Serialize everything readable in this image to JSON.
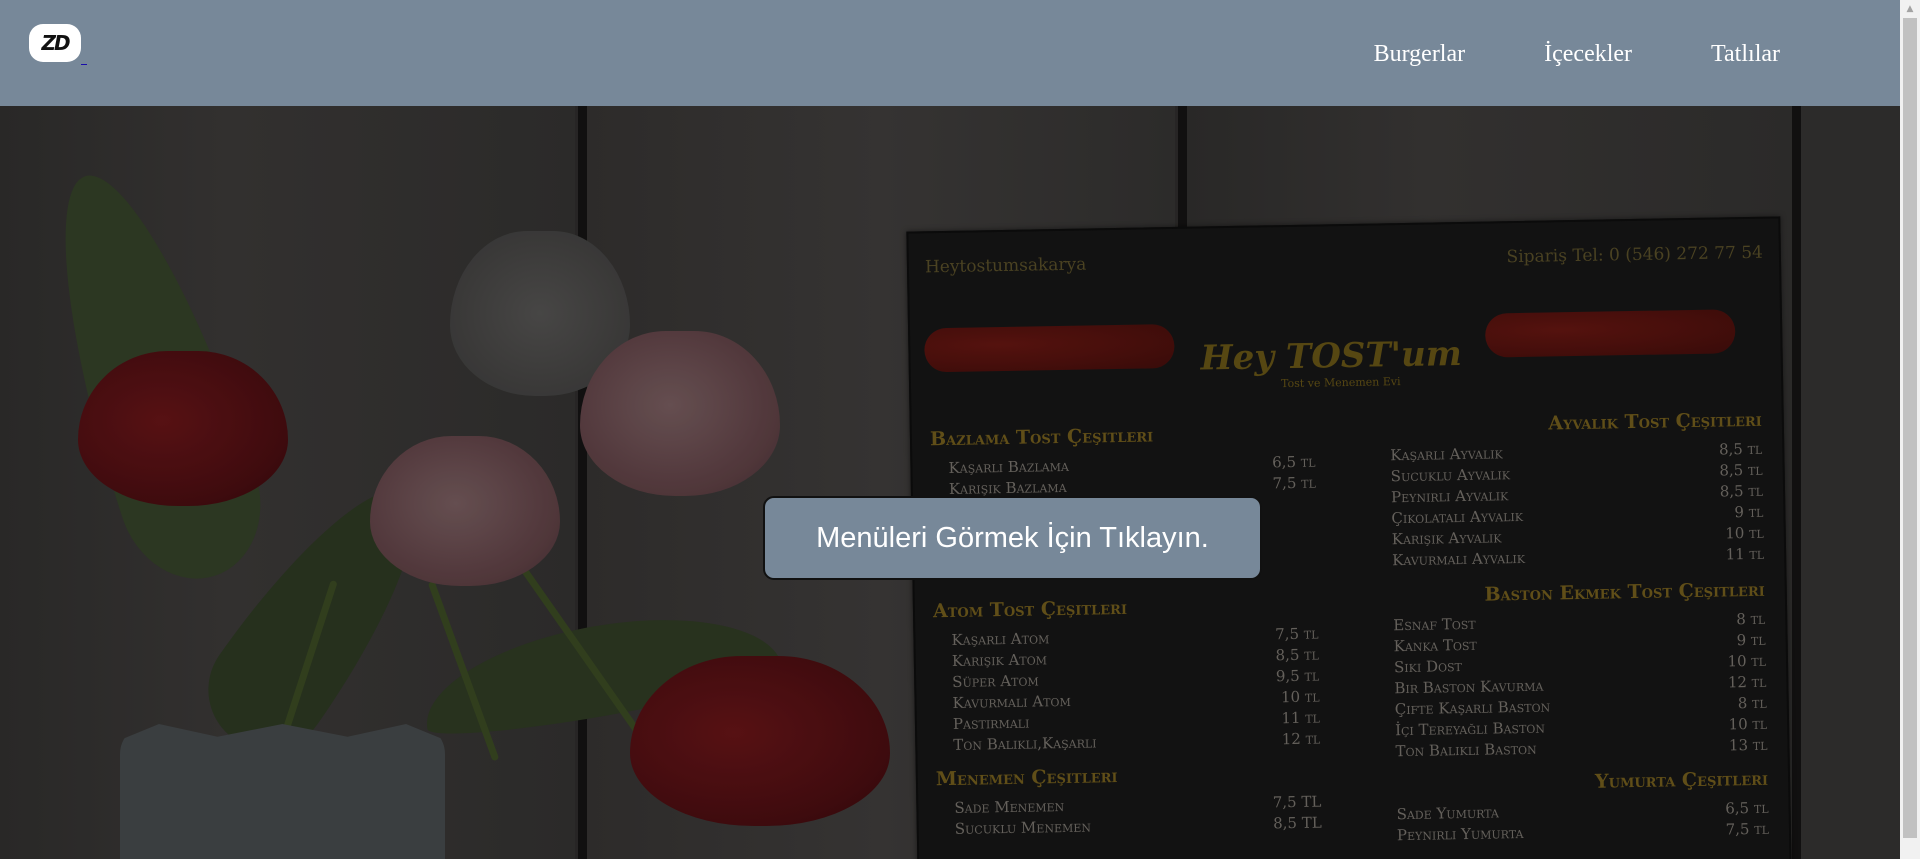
{
  "header": {
    "logo_alt": "ZD logo",
    "logo_text": "ZD",
    "nav": [
      {
        "label": "Burgerlar"
      },
      {
        "label": "İçecekler"
      },
      {
        "label": "Tatlılar"
      }
    ]
  },
  "hero": {
    "cta_label": "Menüleri Görmek İçin Tıklayın.",
    "menu_board": {
      "social": "Heytostumsakarya",
      "phone": "Sipariş Tel: 0 (546) 272 77 54",
      "brand": "Hey TOST'um",
      "brand_sub": "Tost ve Menemen Evi",
      "sections": [
        {
          "title": "Bazlama Tost Çeşitleri",
          "items": [
            {
              "name": "Kaşarlı Bazlama",
              "price": "6,5 tl"
            },
            {
              "name": "Karışık Bazlama",
              "price": "7,5 tl"
            }
          ]
        },
        {
          "title": "Atom Tost Çeşitleri",
          "items": [
            {
              "name": "Kaşarlı Atom",
              "price": "7,5 tl"
            },
            {
              "name": "Karışık Atom",
              "price": "8,5 tl"
            },
            {
              "name": "Süper Atom",
              "price": "9,5 tl"
            },
            {
              "name": "Kavurmalı Atom",
              "price": "10 tl"
            },
            {
              "name": "Pastırmalı",
              "price": "11 tl"
            },
            {
              "name": "Ton Balıklı,Kaşarlı",
              "price": "12 tl"
            }
          ]
        },
        {
          "title": "Menemen Çeşitleri",
          "items": [
            {
              "name": "Sade Menemen",
              "price": "7,5 TL"
            },
            {
              "name": "Sucuklu Menemen",
              "price": "8,5 TL"
            }
          ]
        },
        {
          "title": "Ayvalık Tost Çeşitleri",
          "items": [
            {
              "name": "Kaşarlı Ayvalık",
              "price": "8,5 tl"
            },
            {
              "name": "Sucuklu Ayvalık",
              "price": "8,5 tl"
            },
            {
              "name": "Peynirli Ayvalık",
              "price": "8,5 tl"
            },
            {
              "name": "Çikolatalı Ayvalık",
              "price": "9 tl"
            },
            {
              "name": "Karışık Ayvalık",
              "price": "10 tl"
            },
            {
              "name": "Kavurmalı Ayvalık",
              "price": "11 tl"
            }
          ]
        },
        {
          "title": "Baston Ekmek Tost Çeşitleri",
          "items": [
            {
              "name": "Esnaf Tost",
              "price": "8 tl"
            },
            {
              "name": "Kanka Tost",
              "price": "9 tl"
            },
            {
              "name": "Sıkı Dost",
              "price": "10 tl"
            },
            {
              "name": "Bir Baston Kavurma",
              "price": "12 tl"
            },
            {
              "name": "Çifte Kaşarlı Baston",
              "price": "8 tl"
            },
            {
              "name": "İçi Tereyağlı Baston",
              "price": "10 tl"
            },
            {
              "name": "Ton Balıklı Baston",
              "price": "13 tl"
            }
          ]
        },
        {
          "title": "Yumurta Çeşitleri",
          "items": [
            {
              "name": "Sade Yumurta",
              "price": "6,5 tl"
            },
            {
              "name": "Peynirli Yumurta",
              "price": "7,5 tl"
            }
          ]
        }
      ]
    }
  },
  "colors": {
    "header_bg": "#778899",
    "cta_bg": "#778899",
    "nav_text": "#ffffff"
  }
}
